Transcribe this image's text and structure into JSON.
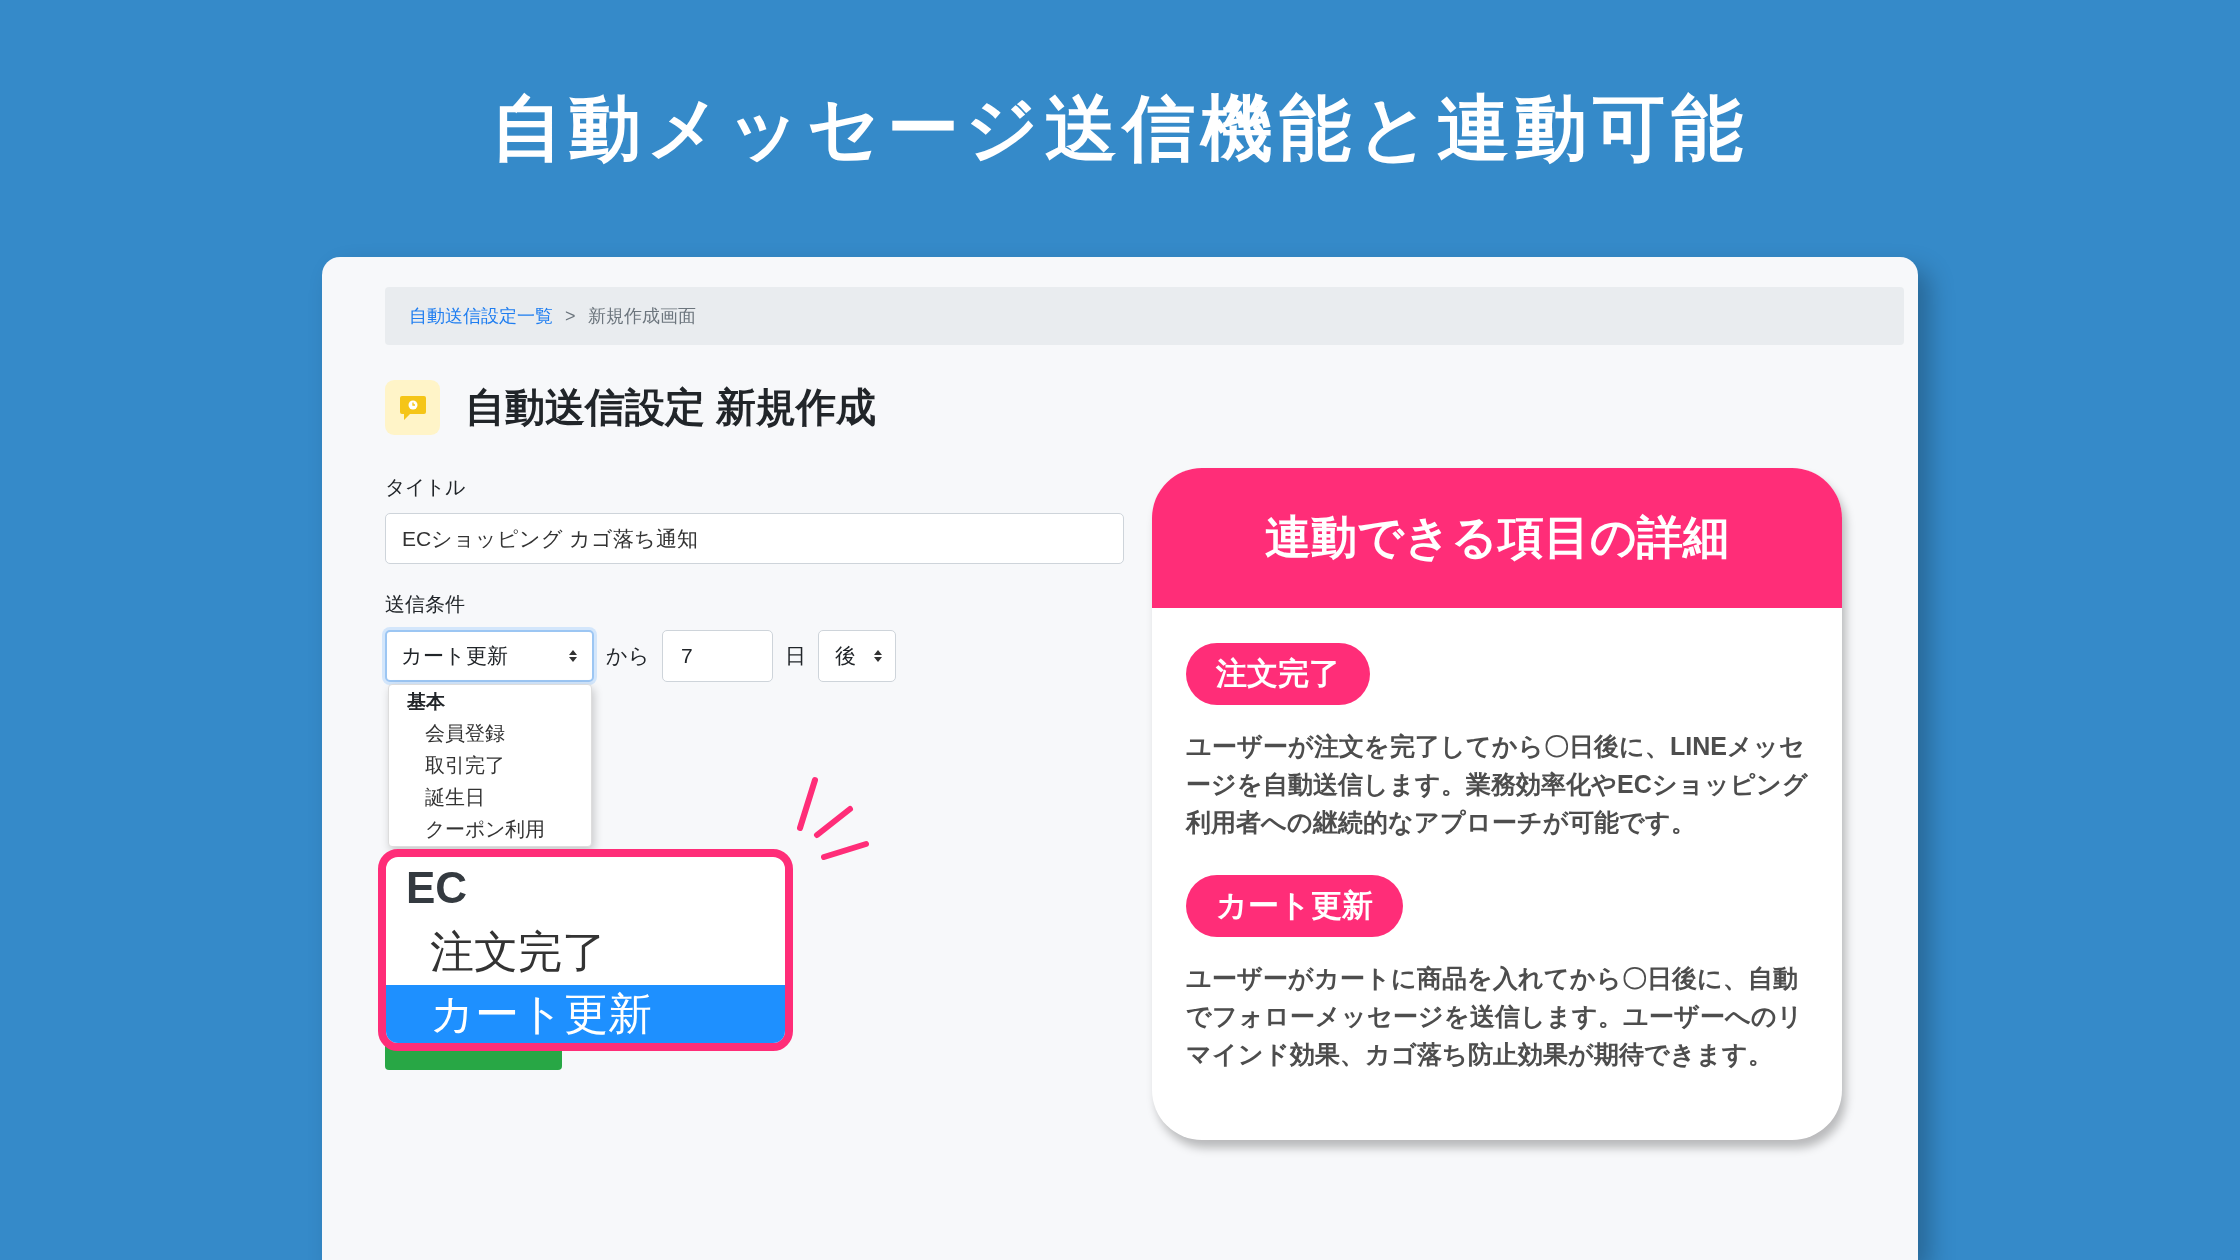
{
  "headline": "自動メッセージ送信機能と連動可能",
  "breadcrumb": {
    "link": "自動送信設定一覧",
    "separator": ">",
    "current": "新規作成画面"
  },
  "page_title": "自動送信設定 新規作成",
  "title_field": {
    "label": "タイトル",
    "value": "ECショッピング カゴ落ち通知"
  },
  "condition": {
    "label": "送信条件",
    "event_select": "カート更新",
    "from_text": "から",
    "days_value": "7",
    "day_unit": "日",
    "timing_select": "後"
  },
  "dropdown": {
    "group": "基本",
    "options": [
      {
        "label": "会員登録",
        "selected": false
      },
      {
        "label": "取引完了",
        "selected": false
      },
      {
        "label": "誕生日",
        "selected": false
      },
      {
        "label": "クーポン利用",
        "selected": false
      }
    ]
  },
  "callout": {
    "group": "EC",
    "options": [
      {
        "label": "注文完了",
        "selected": false
      },
      {
        "label": "カート更新",
        "selected": true
      }
    ]
  },
  "detail_panel": {
    "title": "連動できる項目の詳細",
    "items": [
      {
        "tag": "注文完了",
        "description": "ユーザーが注文を完了してから〇日後に、LINEメッセージを自動送信します。業務効率化やECショッピング利用者への継続的なアプローチが可能です。"
      },
      {
        "tag": "カート更新",
        "description": "ユーザーがカートに商品を入れてから〇日後に、自動でフォローメッセージを送信します。ユーザーへのリマインド効果、カゴ落ち防止効果が期待できます。"
      }
    ]
  }
}
